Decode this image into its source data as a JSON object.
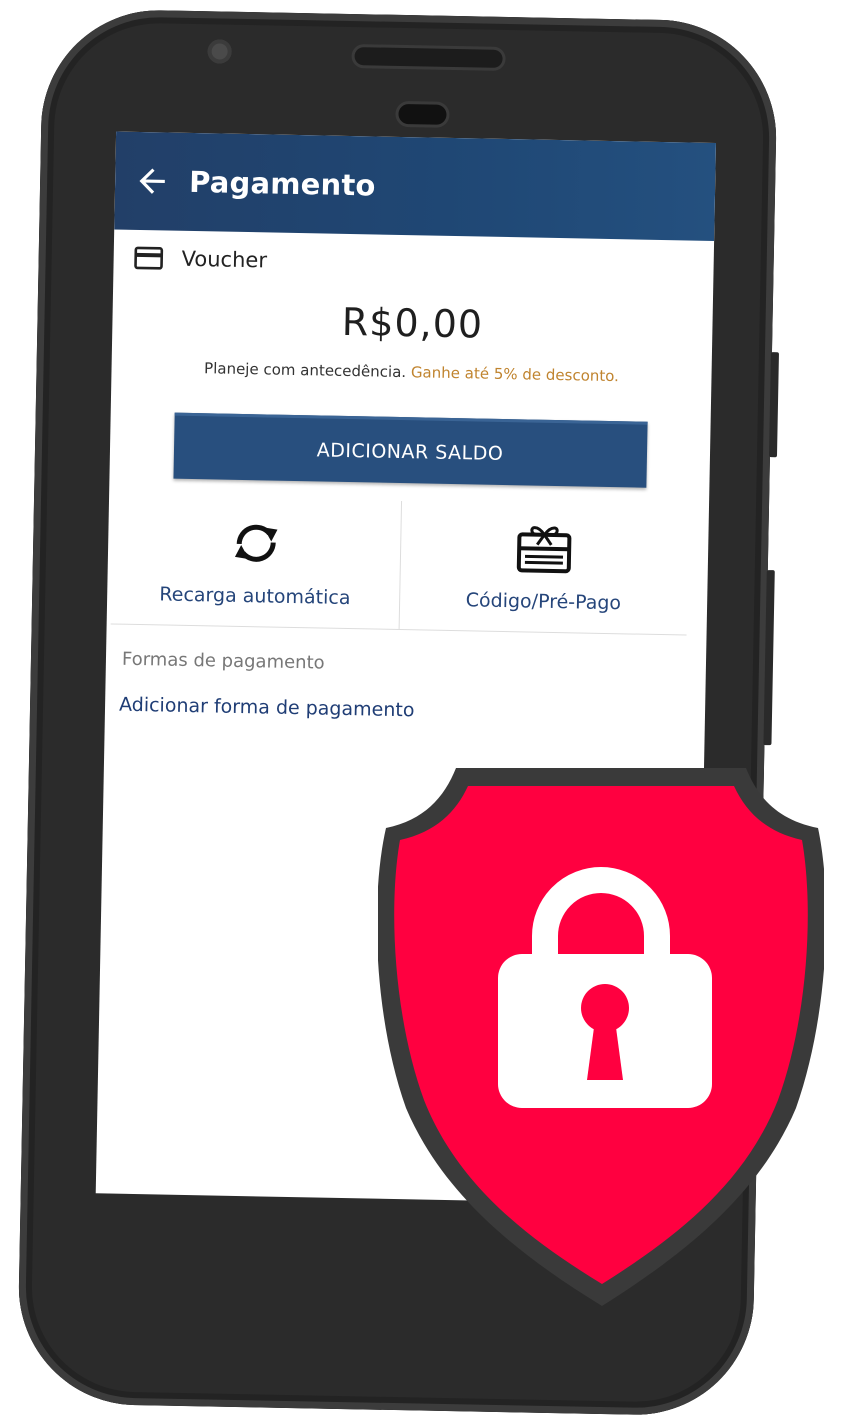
{
  "appbar": {
    "title": "Pagamento"
  },
  "voucher": {
    "label": "Voucher",
    "balance": "R$0,00",
    "promo_text": "Planeje com antecedência.",
    "promo_highlight": "Ganhe até 5% de desconto.",
    "add_balance_label": "ADICIONAR SALDO"
  },
  "actions": [
    {
      "label": "Recarga automática",
      "icon": "refresh-icon"
    },
    {
      "label": "Código/Pré-Pago",
      "icon": "gift-card-icon"
    }
  ],
  "payment_methods": {
    "section_title": "Formas de pagamento",
    "add_label": "Adicionar forma de pagamento"
  },
  "colors": {
    "appbar": "#1f4774",
    "accent_text": "#25457a",
    "promo_highlight": "#c0842f",
    "shield_red": "#ff0040",
    "shield_border": "#3a3a3a"
  },
  "overlay": {
    "icon": "shield-lock-icon"
  }
}
